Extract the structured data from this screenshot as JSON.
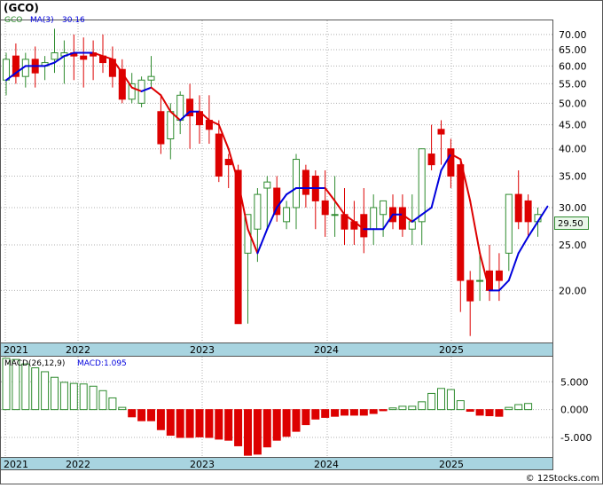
{
  "ticker": "(GCO)",
  "footer": "© 12Stocks.com",
  "colors": {
    "up": "#2e8b2e",
    "down": "#dd0000",
    "ma_up": "#0000dd",
    "ma_down": "#dd0000",
    "macd_pos": "#2e8b2e",
    "macd_neg": "#dd0000",
    "axisband": "#a8d4e0",
    "grid": "#b0b0b0"
  },
  "chart_data": [
    {
      "type": "candlestick",
      "legend": {
        "symbol": "GCO",
        "ma_label": "MA(3)",
        "ma_value": "30.16"
      },
      "last_price_label": "29.50",
      "scale": "log",
      "ylim": [
        15.5,
        75
      ],
      "yticks": [
        "70.00",
        "65.00",
        "60.00",
        "55.00",
        "50.00",
        "45.00",
        "40.00",
        "35.00",
        "30.00",
        "25.00",
        "20.00"
      ],
      "year_labels": [
        "2021",
        "2022",
        "2023",
        "2024",
        "2025"
      ],
      "grid": true,
      "candles": [
        [
          56,
          64,
          52,
          62
        ],
        [
          63,
          67,
          55,
          57
        ],
        [
          57,
          64,
          54,
          62
        ],
        [
          62,
          66,
          54,
          58
        ],
        [
          60,
          63,
          56,
          61
        ],
        [
          62,
          72,
          58,
          64
        ],
        [
          63,
          68,
          55,
          64
        ],
        [
          64,
          70,
          56,
          63
        ],
        [
          63,
          69,
          54,
          62
        ],
        [
          64,
          68,
          56,
          63
        ],
        [
          63,
          70,
          58,
          61
        ],
        [
          62,
          66,
          54,
          57
        ],
        [
          59,
          62,
          50,
          51
        ],
        [
          51,
          58,
          50,
          55
        ],
        [
          50,
          57,
          49,
          56
        ],
        [
          56,
          63,
          54,
          57
        ],
        [
          48,
          52,
          39,
          41
        ],
        [
          42,
          50,
          38,
          48
        ],
        [
          46,
          53,
          43,
          52
        ],
        [
          51,
          55,
          40,
          47
        ],
        [
          48,
          52,
          41,
          45
        ],
        [
          46,
          52,
          41,
          44
        ],
        [
          43,
          46,
          34,
          35
        ],
        [
          38,
          39,
          33,
          37
        ],
        [
          36,
          37,
          20,
          17
        ],
        [
          24,
          27,
          17,
          29
        ],
        [
          27,
          33,
          23,
          32
        ],
        [
          33,
          35,
          27,
          34
        ],
        [
          33,
          35,
          28,
          29
        ],
        [
          28,
          31,
          27,
          30
        ],
        [
          30,
          39,
          27,
          38
        ],
        [
          36,
          37,
          30,
          32
        ],
        [
          35,
          36,
          27,
          31
        ],
        [
          31,
          36,
          26,
          29
        ],
        [
          29,
          35,
          26,
          29
        ],
        [
          29,
          33,
          25,
          27
        ],
        [
          28,
          31,
          25,
          27
        ],
        [
          29,
          33,
          24,
          26
        ],
        [
          27,
          32,
          25,
          30
        ],
        [
          29,
          31,
          26,
          31
        ],
        [
          30,
          32,
          27,
          28
        ],
        [
          30,
          32,
          26,
          27
        ],
        [
          27,
          32,
          25,
          28
        ],
        [
          28,
          37,
          25,
          40
        ],
        [
          39,
          45,
          36,
          37
        ],
        [
          44,
          46,
          37,
          43
        ],
        [
          40,
          42,
          33,
          35
        ],
        [
          37,
          38,
          18,
          21
        ],
        [
          21,
          22,
          16,
          19
        ],
        [
          21,
          24,
          19,
          21
        ],
        [
          22,
          25,
          19,
          20
        ],
        [
          22,
          24,
          19,
          21
        ],
        [
          24,
          29,
          22,
          32
        ],
        [
          32,
          36,
          27,
          28
        ],
        [
          31,
          32,
          26,
          28
        ],
        [
          28,
          30,
          26,
          29
        ]
      ],
      "ma": [
        56,
        58,
        60,
        60,
        60,
        61,
        63,
        64,
        64,
        64,
        63,
        62,
        58,
        54,
        53,
        54,
        52,
        48,
        46,
        48,
        48,
        46,
        45,
        40,
        34,
        27,
        24,
        27,
        30,
        32,
        33,
        33,
        33,
        33,
        31,
        29,
        28,
        27,
        27,
        27,
        29,
        29,
        28,
        29,
        30,
        36,
        39,
        38,
        31,
        24,
        20,
        20,
        21,
        24,
        26,
        28,
        30.16
      ]
    },
    {
      "type": "bar",
      "legend": {
        "label": "MACD(26,12,9)",
        "value_label": "MACD:1.095"
      },
      "ylim": [
        -8.5,
        9.5
      ],
      "yticks": [
        "5.000",
        "0.000",
        "-5.000"
      ],
      "year_labels": [
        "2021",
        "2022",
        "2023",
        "2024",
        "2025"
      ],
      "values": [
        9.2,
        9.0,
        8.2,
        7.5,
        6.8,
        5.8,
        4.9,
        4.7,
        4.6,
        4.2,
        3.4,
        2.1,
        0.4,
        -1.3,
        -2.0,
        -2.0,
        -3.6,
        -4.6,
        -5.0,
        -5.0,
        -4.9,
        -5.0,
        -5.3,
        -5.5,
        -6.5,
        -8.2,
        -8.0,
        -6.7,
        -5.5,
        -4.8,
        -3.9,
        -2.7,
        -1.7,
        -1.4,
        -1.2,
        -1.0,
        -1.0,
        -1.0,
        -0.7,
        -0.2,
        0.3,
        0.6,
        0.6,
        1.4,
        2.9,
        3.8,
        3.6,
        1.6,
        -0.3,
        -1.0,
        -1.1,
        -1.2,
        0.4,
        0.9,
        1.1
      ]
    }
  ]
}
